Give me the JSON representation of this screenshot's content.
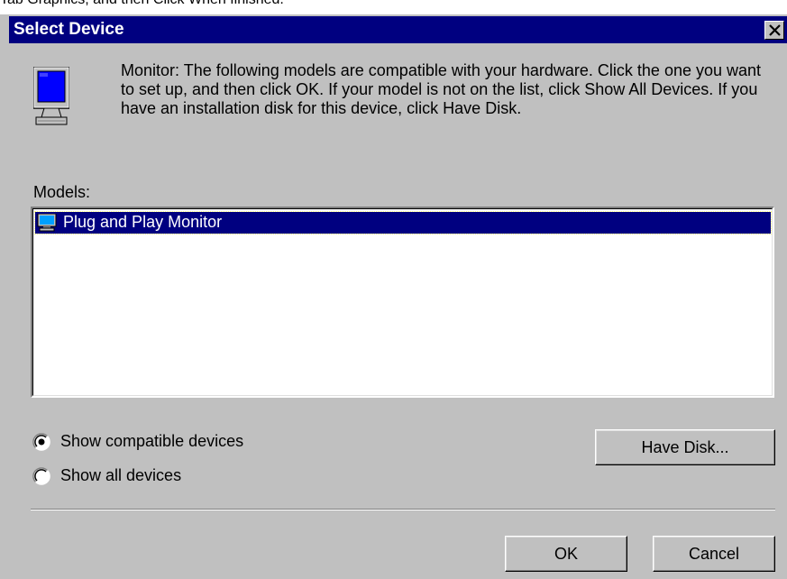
{
  "top_strip": {
    "text": "Tab Graphics, and then Click When finished."
  },
  "dialog": {
    "title": "Select Device",
    "close_icon": "close-icon",
    "monitor_icon": "monitor-icon",
    "description": "Monitor: The following models are compatible with your hardware. Click the one you want to set up, and then click OK. If your model is not on the list, click Show All Devices. If you have an installation disk for this device, click Have Disk.",
    "models_label": "Models:",
    "models": [
      {
        "label": "Plug and Play Monitor",
        "icon": "monitor-icon",
        "selected": true
      }
    ],
    "options": {
      "show_compatible": "Show compatible devices",
      "show_all": "Show all devices",
      "selected": "show_compatible"
    },
    "buttons": {
      "have_disk": "Have Disk...",
      "ok": "OK",
      "cancel": "Cancel"
    },
    "colors": {
      "titlebar": "#000080",
      "face": "#c0c0c0",
      "selection": "#000080"
    }
  }
}
